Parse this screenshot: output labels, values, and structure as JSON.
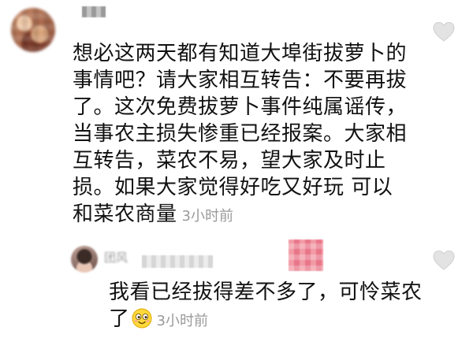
{
  "comment": {
    "text": "想必这两天都有知道大埠街拔萝卜的事情吧？请大家相互转告：不要再拔了。这次免费拔萝卜事件纯属谣传，当事农主损失惨重已经报案。大家相互转告，菜农不易，望大家及时止损。如果大家觉得好吃又好玩 可以和菜农商量",
    "time": "3小时前",
    "like_icon": "heart-outline-icon"
  },
  "reply": {
    "name": "团风",
    "text": "我看已经拔得差不多了，可怜菜农了",
    "emoji_icon": "smiling-face-emoji-icon",
    "time": "3小时前",
    "like_icon": "heart-outline-icon"
  },
  "colors": {
    "text": "#111111",
    "meta": "#9a9a9a",
    "like": "#cfcfcf"
  }
}
